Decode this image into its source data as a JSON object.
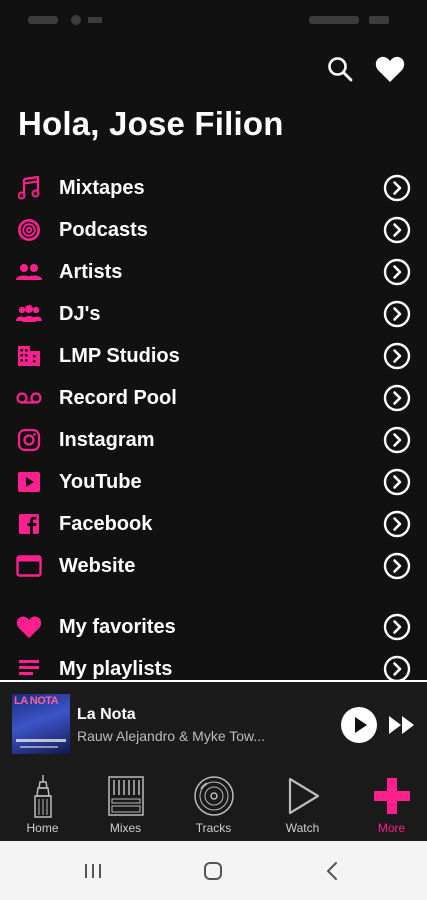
{
  "colors": {
    "accent": "#ff1f8e",
    "background": "#111111",
    "text": "#ffffff"
  },
  "header": {
    "greeting": "Hola, Jose Filion",
    "search_icon": "search-icon",
    "favorites_icon": "heart-icon"
  },
  "menu": {
    "items": [
      {
        "label": "Mixtapes",
        "icon": "music-note-icon"
      },
      {
        "label": "Podcasts",
        "icon": "podcast-icon"
      },
      {
        "label": "Artists",
        "icon": "people-icon"
      },
      {
        "label": "DJ's",
        "icon": "group-icon"
      },
      {
        "label": "LMP Studios",
        "icon": "building-icon"
      },
      {
        "label": "Record Pool",
        "icon": "voicemail-icon"
      },
      {
        "label": "Instagram",
        "icon": "instagram-icon"
      },
      {
        "label": "YouTube",
        "icon": "youtube-icon"
      },
      {
        "label": "Facebook",
        "icon": "facebook-icon"
      },
      {
        "label": "Website",
        "icon": "browser-window-icon"
      },
      {
        "label": "My favorites",
        "icon": "heart-icon"
      },
      {
        "label": "My playlists",
        "icon": "playlist-icon"
      }
    ]
  },
  "player": {
    "title": "La Nota",
    "artist": "Rauw Alejandro & Myke Tow...",
    "art_text": "LA NOTA"
  },
  "tabs": [
    {
      "label": "Home",
      "icon": "skyscraper-icon",
      "active": false
    },
    {
      "label": "Mixes",
      "icon": "mixer-icon",
      "active": false
    },
    {
      "label": "Tracks",
      "icon": "vinyl-icon",
      "active": false
    },
    {
      "label": "Watch",
      "icon": "play-outline-icon",
      "active": false
    },
    {
      "label": "More",
      "icon": "plus-icon",
      "active": true
    }
  ],
  "system_nav": [
    "recent-apps-icon",
    "home-icon",
    "back-icon"
  ]
}
